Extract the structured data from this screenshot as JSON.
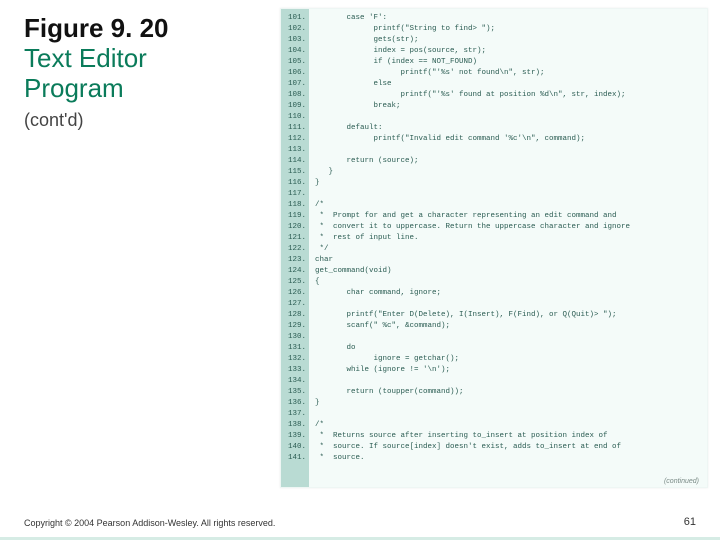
{
  "title": {
    "figure": "Figure 9. 20",
    "line1": "Text Editor",
    "line2": "Program",
    "contd": "(cont'd)"
  },
  "footer": "Copyright © 2004 Pearson Addison-Wesley. All rights reserved.",
  "page_number": "61",
  "continued_label": "(continued)",
  "code": {
    "first_line_no": 101,
    "lines": [
      "       case 'F':",
      "             printf(\"String to find> \");",
      "             gets(str);",
      "             index = pos(source, str);",
      "             if (index == NOT_FOUND)",
      "                   printf(\"'%s' not found\\n\", str);",
      "             else",
      "                   printf(\"'%s' found at position %d\\n\", str, index);",
      "             break;",
      "",
      "       default:",
      "             printf(\"Invalid edit command '%c'\\n\", command);",
      "",
      "       return (source);",
      "   }",
      "}",
      "",
      "/*",
      " *  Prompt for and get a character representing an edit command and",
      " *  convert it to uppercase. Return the uppercase character and ignore",
      " *  rest of input line.",
      " */",
      "char",
      "get_command(void)",
      "{",
      "       char command, ignore;",
      "",
      "       printf(\"Enter D(Delete), I(Insert), F(Find), or Q(Quit)> \");",
      "       scanf(\" %c\", &command);",
      "",
      "       do",
      "             ignore = getchar();",
      "       while (ignore != '\\n');",
      "",
      "       return (toupper(command));",
      "}",
      "",
      "/*",
      " *  Returns source after inserting to_insert at position index of",
      " *  source. If source[index] doesn't exist, adds to_insert at end of",
      " *  source."
    ]
  }
}
